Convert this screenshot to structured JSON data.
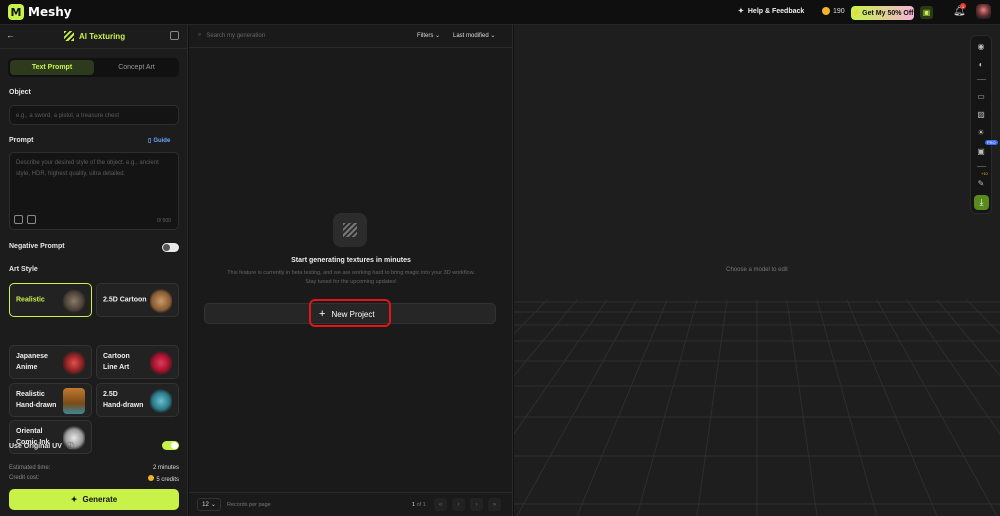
{
  "app": {
    "name": "Meshy"
  },
  "topbar": {
    "help": "Help & Feedback",
    "credits": "190",
    "promo": "Get My 50% Off",
    "notifications": "1"
  },
  "panel": {
    "title": "AI Texturing",
    "tabs": [
      "Text Prompt",
      "Concept Art"
    ],
    "object_label": "Object",
    "object_placeholder": "e.g., a sword, a pistol, a treasure chest",
    "prompt_label": "Prompt",
    "guide": "Guide",
    "prompt_placeholder": "Describe your desired style of the object. e.g., ancient style, HDR, highest quality, ultra detailed.",
    "prompt_counter": "0/ 500",
    "negative_prompt": "Negative Prompt",
    "art_style_label": "Art Style",
    "styles": [
      "Realistic",
      "2.5D Cartoon",
      "Japanese\nAnime",
      "Cartoon\nLine Art",
      "Realistic\nHand-drawn",
      "2.5D\nHand-drawn",
      "Oriental\nComic Ink"
    ],
    "selected_style": "Realistic",
    "use_uv": "Use Original UV",
    "use_uv_on": true,
    "est_label": "Estimated time:",
    "est_value": "2 minutes",
    "cost_label": "Credit cost:",
    "cost_value": "5 credits",
    "generate": "Generate"
  },
  "list": {
    "search_placeholder": "Search my generation",
    "filters": "Filters",
    "sort": "Last modified",
    "empty_title": "Start generating textures in minutes",
    "empty_desc1": "This feature is currently in beta testing, and we are working hard to bring magic into your 3D workflow.",
    "empty_desc2": "Stay tuned for the upcoming updates!",
    "new_project": "New Project",
    "per_page": "12",
    "per_page_label": "Records per page",
    "page_current": "1",
    "page_of": "of 1"
  },
  "viewport": {
    "hint": "Choose a model to edit",
    "pro_badge": "PRO",
    "credit_hint": "+10"
  },
  "colors": {
    "accent": "#c8f24a",
    "highlight": "#e01515",
    "bg": "#1c1c1c"
  }
}
